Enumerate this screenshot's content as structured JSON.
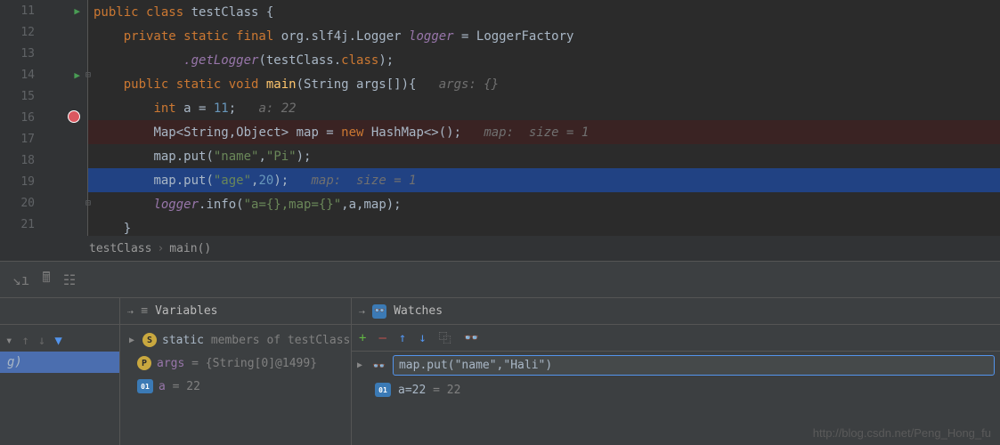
{
  "gutter": {
    "lines": [
      "11",
      "12",
      "13",
      "14",
      "15",
      "16",
      "17",
      "18",
      "19",
      "20",
      "21"
    ]
  },
  "code": {
    "l11": {
      "kw1": "public class ",
      "cls": "testClass",
      "brace": " {"
    },
    "l12": {
      "kw": "private static final ",
      "type": "org.slf4j.Logger ",
      "field": "logger",
      "eq": " = LoggerFactory"
    },
    "l13": {
      "m": ".getLogger",
      "args": "(testClass.",
      "kw": "class",
      "end": ");"
    },
    "l14": {
      "kw": "public static void ",
      "m": "main",
      "sig": "(String args[]){",
      "hint": "   args: {}"
    },
    "l15": {
      "kw": "int ",
      "v": "a = ",
      "num": "11",
      "end": ";",
      "hint": "   a: 22"
    },
    "l16": {
      "type": "Map<String,Object> map = ",
      "kw": "new ",
      "ctor": "HashMap<>();",
      "hint": "   map:  size = 1"
    },
    "l17": {
      "call": "map.put(",
      "s1": "\"name\"",
      "c": ",",
      "s2": "\"Pi\"",
      "end": ");"
    },
    "l18": {
      "call": "map.put(",
      "s1": "\"age\"",
      "c": ",",
      "num": "20",
      "end": ");",
      "hint": "   map:  size = 1"
    },
    "l19": {
      "field": "logger",
      "m": ".info(",
      "s": "\"a={},map={}\"",
      "args": ",a,map);"
    },
    "l20": {
      "brace": "}"
    },
    "l21": {
      "brace": "}"
    }
  },
  "breadcrumb": {
    "a": "testClass",
    "b": "main()"
  },
  "panels": {
    "variables_label": "Variables",
    "watches_label": "Watches",
    "frame_g": "g)"
  },
  "vars": {
    "static_line": {
      "name": "static ",
      "rest": "members of testClass"
    },
    "args_line": {
      "name": "args",
      "val": " = {String[0]@1499}"
    },
    "a_line": {
      "name": "a",
      "val": " = 22"
    }
  },
  "watch": {
    "input_value": "map.put(\"name\",\"Hali\")",
    "result_label": "a=22",
    "result_val": " = 22"
  },
  "watermark": "http://blog.csdn.net/Peng_Hong_fu"
}
